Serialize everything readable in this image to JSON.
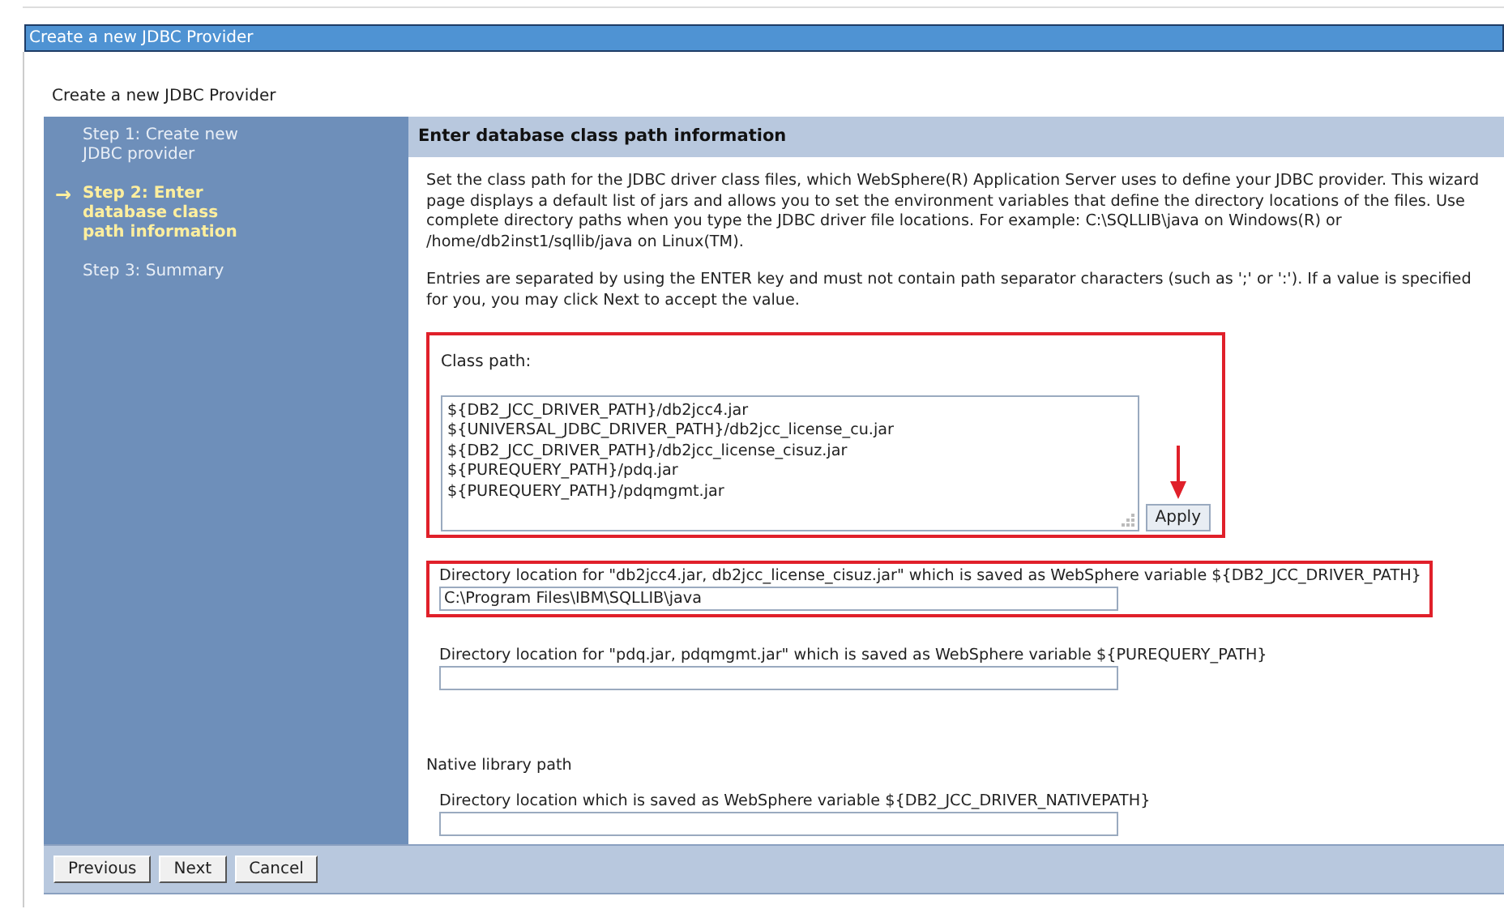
{
  "window": {
    "title": "Create a new JDBC Provider"
  },
  "page_title": "Create a new JDBC Provider",
  "steps": [
    {
      "label": "Step 1: Create new JDBC provider",
      "selected": false
    },
    {
      "label": "Step 2: Enter database class path information",
      "selected": true
    },
    {
      "label": "Step 3: Summary",
      "selected": false
    }
  ],
  "current_step_marker": "→",
  "section_title": "Enter database class path information",
  "paragraphs": [
    "Set the class path for the JDBC driver class files, which WebSphere(R) Application Server uses to define your JDBC provider. This wizard page displays a default list of jars and allows you to set the environment variables that define the directory locations of the files. Use complete directory paths when you type the JDBC driver file locations. For example: C:\\SQLLIB\\java on Windows(R) or /home/db2inst1/sqllib/java on Linux(TM).",
    "Entries are separated by using the ENTER key and must not contain path separator characters (such as ';' or ':'). If a value is specified for you, you may click Next to accept the value."
  ],
  "class_path": {
    "label": "Class path:",
    "highlighted": true,
    "lines": [
      "${DB2_JCC_DRIVER_PATH}/db2jcc4.jar",
      "${UNIVERSAL_JDBC_DRIVER_PATH}/db2jcc_license_cu.jar",
      "${DB2_JCC_DRIVER_PATH}/db2jcc_license_cisuz.jar",
      "${PUREQUERY_PATH}/pdq.jar",
      "${PUREQUERY_PATH}/pdqmgmt.jar"
    ],
    "apply_button": "Apply"
  },
  "directories": [
    {
      "label": "Directory location for \"db2jcc4.jar, db2jcc_license_cisuz.jar\" which is saved as WebSphere variable ${DB2_JCC_DRIVER_PATH}",
      "value": "C:\\Program Files\\IBM\\SQLLIB\\java",
      "highlighted": true
    },
    {
      "label": "Directory location for \"pdq.jar, pdqmgmt.jar\" which is saved as WebSphere variable ${PUREQUERY_PATH}",
      "highlighted": false
    }
  ],
  "native_library": {
    "heading": "Native library path",
    "label": "Directory location which is saved as WebSphere variable ${DB2_JCC_DRIVER_NATIVEPATH}"
  },
  "buttons": [
    "Previous",
    "Next",
    "Cancel"
  ]
}
